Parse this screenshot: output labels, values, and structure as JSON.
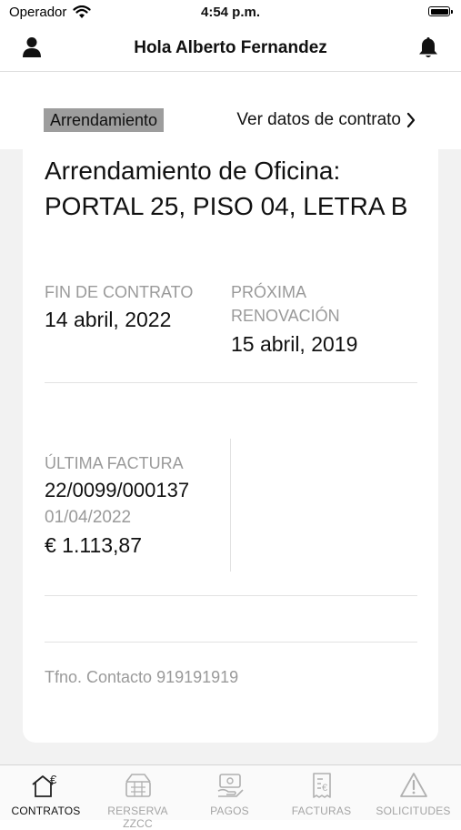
{
  "status_bar": {
    "carrier": "Operador",
    "time": "4:54 p.m."
  },
  "header": {
    "title": "Hola Alberto Fernandez",
    "left_icon": "user-icon",
    "right_icon": "bell-icon"
  },
  "contract": {
    "tag": "Arrendamiento",
    "link_label": "Ver datos de contrato",
    "title": "Arrendamiento de Oficina: PORTAL 25, PISO 04, LETRA B",
    "end_label": "FIN DE CONTRATO",
    "end_value": "14 abril, 2022",
    "renewal_label": "PRÓXIMA RENOVACIÓN",
    "renewal_value": "15 abril, 2019"
  },
  "invoice": {
    "label": "ÚLTIMA FACTURA",
    "number": "22/0099/000137",
    "date": "01/04/2022",
    "amount": "€ 1.113,87"
  },
  "contact": {
    "phone_text": "Tfno. Contacto 919191919"
  },
  "tabbar": {
    "tabs": [
      {
        "label": "CONTRATOS",
        "icon": "contracts-icon",
        "active": true
      },
      {
        "label": "RERSERVA ZZCC",
        "icon": "reservation-icon",
        "active": false
      },
      {
        "label": "PAGOS",
        "icon": "payments-icon",
        "active": false
      },
      {
        "label": "FACTURAS",
        "icon": "invoices-icon",
        "active": false
      },
      {
        "label": "SOLICITUDES",
        "icon": "warning-icon",
        "active": false
      }
    ]
  },
  "colors": {
    "tag_background": "#9d9d9d",
    "page_background": "#f2f2f2",
    "muted_text": "#9a9a9a",
    "inactive_tab": "#a4a4a4"
  }
}
